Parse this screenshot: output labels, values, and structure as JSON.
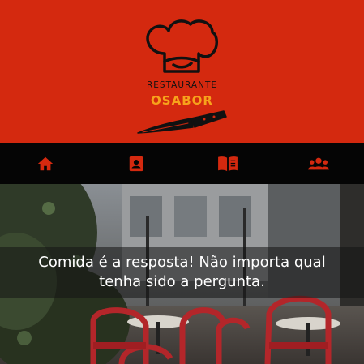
{
  "header": {
    "brand_top": "RESTAURANTE",
    "brand_main": "OSABOR",
    "accent_color": "#d4290f",
    "brand_color": "#f7a21b"
  },
  "nav": {
    "items": [
      {
        "icon": "home-icon"
      },
      {
        "icon": "contact-card-icon"
      },
      {
        "icon": "menu-book-icon"
      },
      {
        "icon": "users-icon"
      }
    ]
  },
  "hero": {
    "caption_line1": "Comida é a resposta! Não importa qual",
    "caption_line2": "tenha sido a pergunta."
  }
}
